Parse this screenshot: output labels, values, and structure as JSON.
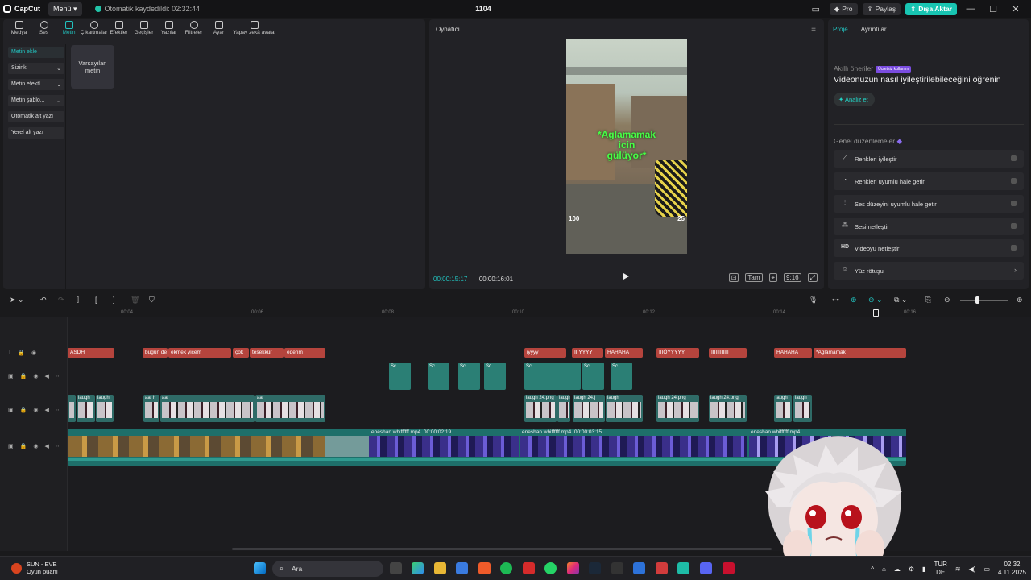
{
  "titlebar": {
    "app_name": "CapCut",
    "menu_label": "Menü",
    "autosave_text": "Otomatik kaydedildi: 02:32:44",
    "project_name": "1104",
    "pro_label": "Pro",
    "share_label": "Paylaş",
    "export_label": "Dışa Aktar"
  },
  "main_tabs": [
    "Medya",
    "Ses",
    "Metin",
    "Çıkartmalar",
    "Efektler",
    "Geçişler",
    "Yazılar",
    "Filtreler",
    "Ayar",
    "Yapay zekâ avatar"
  ],
  "active_tab": "Metin",
  "text_submenu": [
    {
      "label": "Metin ekle",
      "dropdown": false
    },
    {
      "label": "Sizinki",
      "dropdown": true
    },
    {
      "label": "Metin efektl...",
      "dropdown": true
    },
    {
      "label": "Metin şablo...",
      "dropdown": true
    },
    {
      "label": "Otomatik alt yazı",
      "dropdown": false
    },
    {
      "label": "Yerel alt yazı",
      "dropdown": false
    }
  ],
  "preset": {
    "label": "Varsayılan metin"
  },
  "player": {
    "title": "Oynatıcı",
    "caption_line1": "*Aglamamak",
    "caption_line2": "icin",
    "caption_line3": "gülüyor*",
    "hud_left": "100",
    "hud_right": "25",
    "current_time": "00:00:15:17",
    "total_time": "00:00:16:01",
    "icons": [
      "crop-icon",
      "ratio-icon",
      "fit-icon",
      "quality-icon",
      "fullscreen-icon"
    ],
    "ratio_label": "Tam",
    "quality_label": "9:16"
  },
  "right_panel": {
    "tabs": [
      "Proje",
      "Ayrıntılar"
    ],
    "active_tab": "Proje",
    "smart_title": "Akıllı öneriler",
    "smart_badge": "Ücretsiz kullanım",
    "smart_desc": "Videonuzun nasıl iyileştirilebileceğini öğrenin",
    "analyze_label": "Analiz et",
    "general_title": "Genel düzenlemeler",
    "general_items": [
      {
        "label": "Renkleri iyileştir",
        "icon": "magic-wand-icon",
        "type": "toggle"
      },
      {
        "label": "Renkleri uyumlu hale getir",
        "icon": "color-match-icon",
        "type": "toggle"
      },
      {
        "label": "Ses düzeyini uyumlu hale getir",
        "icon": "volume-adjust-icon",
        "type": "toggle"
      },
      {
        "label": "Sesi netleştir",
        "icon": "audio-enhance-icon",
        "type": "toggle"
      },
      {
        "label": "Videoyu netleştir",
        "icon": "hd-icon",
        "type": "toggle"
      },
      {
        "label": "Yüz rötuşu",
        "icon": "face-retouch-icon",
        "type": "chevron"
      }
    ]
  },
  "ruler_ticks": [
    "00:04",
    "00:06",
    "00:08",
    "00:10",
    "00:12",
    "00:14",
    "00:16"
  ],
  "text_clips": [
    "ASDH",
    "bugün de",
    "ekmek yicem",
    "çok",
    "tesekkür",
    "ederim",
    "iyyyy",
    "IIIYYYY",
    "HAHAHA",
    "IIIÖYYYYY",
    "IIIIIIIIIIII",
    "HAHAHA",
    "*Aglamamak"
  ],
  "sticker_label": "Sc",
  "image_clips": [
    "laugh",
    "laugh",
    "aa_h",
    "aa",
    "aa",
    "laugh 24.png",
    "laugh",
    "laugh 24.j",
    "laugh",
    "laugh 24.png",
    "laugh 24.png",
    "laugh",
    "laugh"
  ],
  "main_track": {
    "clip1_label": "eneshan whiffffff.mp4",
    "clip1_duration": "00:00:02:19",
    "clip2_label": "eneshan whiffffff.mp4",
    "clip2_duration": "00:00:03:15",
    "clip3_label": "eneshan whiffffff.mp4"
  },
  "taskbar": {
    "weather_title": "SUN - EVE",
    "weather_sub": "Oyun puanı",
    "search_placeholder": "Ara",
    "lang_top": "TUR",
    "lang_bottom": "DE",
    "time": "02:32",
    "date": "4.11.2025"
  },
  "colors": {
    "accent": "#22c4c0",
    "export": "#18c5b2",
    "text_clip": "#b5443d",
    "video_track": "#1e6f6a"
  }
}
